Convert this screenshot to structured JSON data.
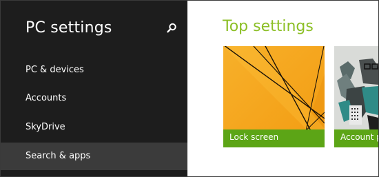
{
  "app": {
    "title": "PC settings"
  },
  "icons": {
    "search": "search-icon"
  },
  "sidebar": {
    "items": [
      {
        "label": "PC & devices",
        "selected": false
      },
      {
        "label": "Accounts",
        "selected": false
      },
      {
        "label": "SkyDrive",
        "selected": false
      },
      {
        "label": "Search & apps",
        "selected": true
      }
    ]
  },
  "main": {
    "section_title": "Top settings",
    "tiles": [
      {
        "label": "Lock screen"
      },
      {
        "label": "Account p"
      }
    ]
  },
  "colors": {
    "sidebar_bg": "#1d1d1d",
    "selected_bg": "#3b3b3b",
    "accent_green": "#8cbf26",
    "tile_label_bar": "#5ca516",
    "lock_tile_orange": "#f5a623"
  }
}
